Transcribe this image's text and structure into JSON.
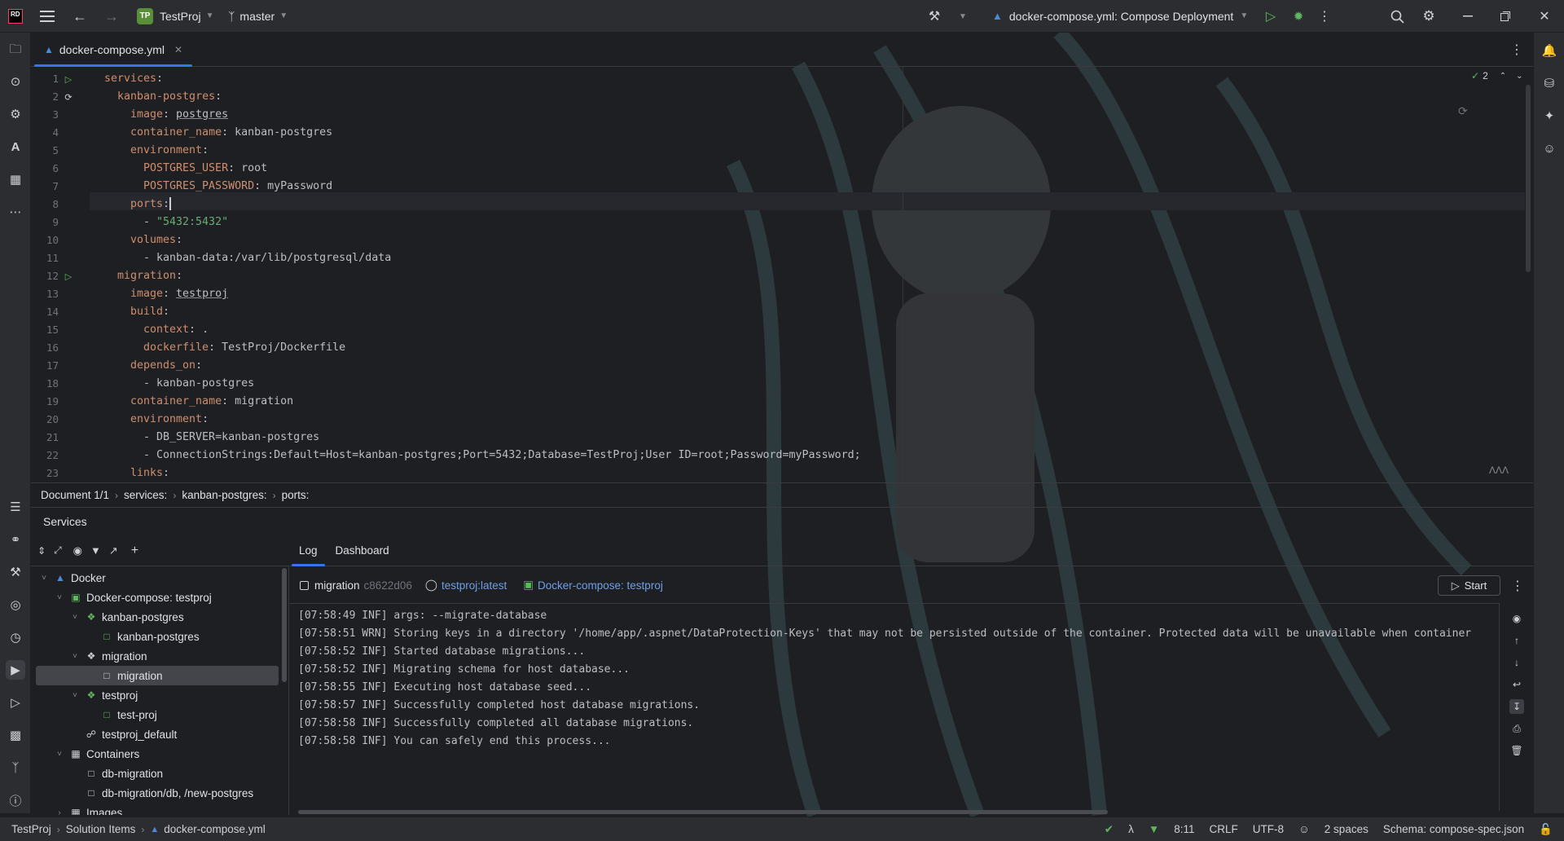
{
  "titlebar": {
    "project_initials": "TP",
    "project_name": "TestProj",
    "branch": "master",
    "run_config": "docker-compose.yml: Compose Deployment"
  },
  "editor_tab": {
    "filename": "docker-compose.yml"
  },
  "editor": {
    "inspection_count": "2",
    "lines": [
      {
        "n": "1",
        "indent": 0,
        "key": "services",
        "sep": ":",
        "value": ""
      },
      {
        "n": "2",
        "indent": 1,
        "key": "kanban-postgres",
        "sep": ":",
        "value": ""
      },
      {
        "n": "3",
        "indent": 2,
        "key": "image",
        "sep": ": ",
        "value": "postgres",
        "underline": true
      },
      {
        "n": "4",
        "indent": 2,
        "key": "container_name",
        "sep": ": ",
        "value": "kanban-postgres"
      },
      {
        "n": "5",
        "indent": 2,
        "key": "environment",
        "sep": ":",
        "value": ""
      },
      {
        "n": "6",
        "indent": 3,
        "key": "POSTGRES_USER",
        "sep": ": ",
        "value": "root"
      },
      {
        "n": "7",
        "indent": 3,
        "key": "POSTGRES_PASSWORD",
        "sep": ": ",
        "value": "myPassword"
      },
      {
        "n": "8",
        "indent": 2,
        "key": "ports",
        "sep": ":",
        "value": ""
      },
      {
        "n": "9",
        "indent": 3,
        "key": "",
        "sep": "- ",
        "value": "\"5432:5432\"",
        "string": true
      },
      {
        "n": "10",
        "indent": 2,
        "key": "volumes",
        "sep": ":",
        "value": ""
      },
      {
        "n": "11",
        "indent": 3,
        "key": "",
        "sep": "- ",
        "value": "kanban-data:/var/lib/postgresql/data"
      },
      {
        "n": "12",
        "indent": 1,
        "key": "migration",
        "sep": ":",
        "value": ""
      },
      {
        "n": "13",
        "indent": 2,
        "key": "image",
        "sep": ": ",
        "value": "testproj",
        "underline": true
      },
      {
        "n": "14",
        "indent": 2,
        "key": "build",
        "sep": ":",
        "value": ""
      },
      {
        "n": "15",
        "indent": 3,
        "key": "context",
        "sep": ": ",
        "value": "."
      },
      {
        "n": "16",
        "indent": 3,
        "key": "dockerfile",
        "sep": ": ",
        "value": "TestProj/Dockerfile"
      },
      {
        "n": "17",
        "indent": 2,
        "key": "depends_on",
        "sep": ":",
        "value": ""
      },
      {
        "n": "18",
        "indent": 3,
        "key": "",
        "sep": "- ",
        "value": "kanban-postgres"
      },
      {
        "n": "19",
        "indent": 2,
        "key": "container_name",
        "sep": ": ",
        "value": "migration"
      },
      {
        "n": "20",
        "indent": 2,
        "key": "environment",
        "sep": ":",
        "value": ""
      },
      {
        "n": "21",
        "indent": 3,
        "key": "",
        "sep": "- ",
        "value": "DB_SERVER=kanban-postgres"
      },
      {
        "n": "22",
        "indent": 3,
        "key": "",
        "sep": "- ",
        "value": "ConnectionStrings:Default=Host=kanban-postgres;Port=5432;Database=TestProj;User ID=root;Password=myPassword;"
      },
      {
        "n": "23",
        "indent": 2,
        "key": "links",
        "sep": ":",
        "value": ""
      }
    ]
  },
  "breadcrumbs": [
    "Document 1/1",
    "services:",
    "kanban-postgres:",
    "ports:"
  ],
  "services": {
    "title": "Services",
    "tree": [
      {
        "label": "Docker",
        "level": 0,
        "chev": "down",
        "icon": "docker"
      },
      {
        "label": "Docker-compose: testproj",
        "level": 1,
        "chev": "down",
        "icon": "compose"
      },
      {
        "label": "kanban-postgres",
        "level": 2,
        "chev": "down",
        "icon": "service-green"
      },
      {
        "label": "kanban-postgres",
        "level": 3,
        "chev": "",
        "icon": "container-green"
      },
      {
        "label": "migration",
        "level": 2,
        "chev": "down",
        "icon": "service-grey"
      },
      {
        "label": "migration",
        "level": 3,
        "chev": "",
        "icon": "container-grey",
        "selected": true
      },
      {
        "label": "testproj",
        "level": 2,
        "chev": "down",
        "icon": "service-green"
      },
      {
        "label": "test-proj",
        "level": 3,
        "chev": "",
        "icon": "container-green"
      },
      {
        "label": "testproj_default",
        "level": 2,
        "chev": "",
        "icon": "network"
      },
      {
        "label": "Containers",
        "level": 1,
        "chev": "down",
        "icon": "containers"
      },
      {
        "label": "db-migration",
        "level": 2,
        "chev": "",
        "icon": "container-grey"
      },
      {
        "label": "db-migration/db, /new-postgres",
        "level": 2,
        "chev": "",
        "icon": "container-grey"
      },
      {
        "label": "Images",
        "level": 1,
        "chev": "right",
        "icon": "images"
      }
    ],
    "log_tabs": [
      "Log",
      "Dashboard"
    ],
    "log_header": {
      "container": "migration",
      "container_id": "c8622d06",
      "image": "testproj:latest",
      "compose": "Docker-compose: testproj",
      "start_label": "Start"
    },
    "log_lines": [
      "[07:58:49 INF] args: --migrate-database",
      "[07:58:51 WRN] Storing keys in a directory '/home/app/.aspnet/DataProtection-Keys' that may not be persisted outside of the container. Protected data will be unavailable when container",
      "[07:58:52 INF] Started database migrations...",
      "[07:58:52 INF] Migrating schema for host database...",
      "[07:58:55 INF] Executing host database seed...",
      "[07:58:57 INF] Successfully completed host database migrations.",
      "[07:58:58 INF] Successfully completed all database migrations.",
      "[07:58:58 INF] You can safely end this process..."
    ]
  },
  "statusbar": {
    "path": [
      "TestProj",
      "Solution Items",
      "docker-compose.yml"
    ],
    "position": "8:11",
    "line_sep": "CRLF",
    "encoding": "UTF-8",
    "indent": "2 spaces",
    "schema": "Schema: compose-spec.json"
  },
  "colors": {
    "accent": "#3574f0",
    "run_green": "#5fb85f",
    "key_orange": "#cf8e6d",
    "string_green": "#6aab73",
    "link_blue": "#6f9fe8"
  }
}
